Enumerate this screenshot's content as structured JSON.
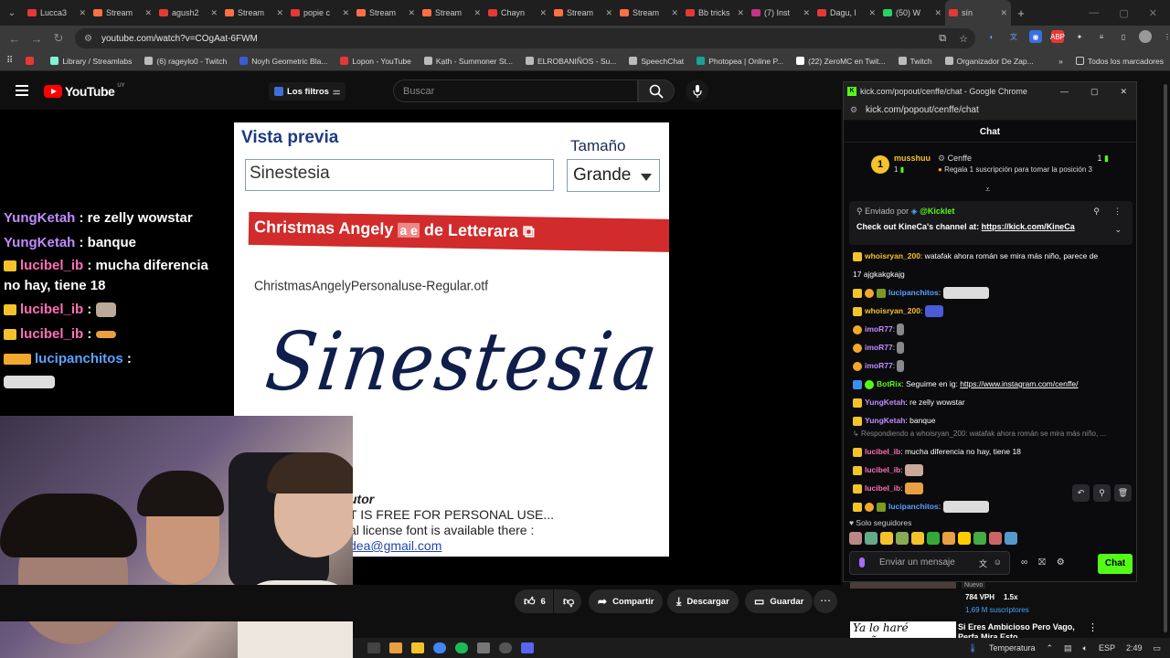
{
  "browser": {
    "tabs": [
      {
        "label": "Lucca3",
        "color": "#e53935"
      },
      {
        "label": "Stream",
        "color": "#ff7043"
      },
      {
        "label": "agush2",
        "color": "#e53935"
      },
      {
        "label": "Stream",
        "color": "#ff7043"
      },
      {
        "label": "popie c",
        "color": "#e53935"
      },
      {
        "label": "Stream",
        "color": "#ff7043"
      },
      {
        "label": "Stream",
        "color": "#ff7043"
      },
      {
        "label": "Chayn",
        "color": "#e53935"
      },
      {
        "label": "Stream",
        "color": "#ff7043"
      },
      {
        "label": "Stream",
        "color": "#ff7043"
      },
      {
        "label": "Bb tricks",
        "color": "#e53935"
      },
      {
        "label": "(7) Inst",
        "color": "#c13584"
      },
      {
        "label": "Dagu, l",
        "color": "#e53935"
      },
      {
        "label": "(50) W",
        "color": "#25d366"
      },
      {
        "label": "sín",
        "color": "#e53935"
      }
    ],
    "url": "youtube.com/watch?v=COgAat-6FWM",
    "bookmarks": [
      {
        "label": "",
        "color": "#e53935"
      },
      {
        "label": "Library / Streamlabs",
        "color": "#80f5d2"
      },
      {
        "label": "(6) rageylo0 - Twitch",
        "color": "#bbbbbb"
      },
      {
        "label": "Noyh Geometric Bla...",
        "color": "#3b5bd6"
      },
      {
        "label": "Lopon - YouTube",
        "color": "#e53935"
      },
      {
        "label": "Kạth - Summoner St...",
        "color": "#bbbbbb"
      },
      {
        "label": "ELROBANIÑOS - Su...",
        "color": "#bbbbbb"
      },
      {
        "label": "SpeechChat",
        "color": "#bbbbbb"
      },
      {
        "label": "Photopea | Online P...",
        "color": "#18a497"
      },
      {
        "label": "(22) ZeroMC en Twit...",
        "color": "#ffffff"
      },
      {
        "label": "Twitch",
        "color": "#bbbbbb"
      },
      {
        "label": "Organizador De Zap...",
        "color": "#bbbbbb"
      }
    ],
    "all_bookmarks": "Todos los marcadores"
  },
  "youtube": {
    "logo": "YouTube",
    "region": "UY",
    "filters": "Los filtros",
    "search_placeholder": "Buscar",
    "likes": "6",
    "share": "Compartir",
    "download": "Descargar",
    "save": "Guardar"
  },
  "preview": {
    "title": "Vista previa",
    "size_label": "Tamaño",
    "input_value": "Sinestesia",
    "select_value": "Grande",
    "red_banner": "Christmas Angely",
    "red_banner_glyphs": "a e",
    "red_banner_author": "de Letterara",
    "filename": "ChristmasAngelyPersonaluse-Regular.otf",
    "script_text": "Sinestesia",
    "foot1": "utor",
    "foot2": "T IS FREE FOR PERSONAL USE...",
    "foot3": "al license font is available there :",
    "foot4": "dea@gmail.com"
  },
  "overlay_chat": [
    {
      "user": "YungKetah",
      "text": " : re zelly wowstar"
    },
    {
      "user": "YungKetah",
      "text": " : banque"
    },
    {
      "user": "lucibel_ib",
      "text": " : mucha diferencia no hay, tiene 18"
    },
    {
      "user": "lucibel_ib",
      "text": " :"
    },
    {
      "user": "lucibel_ib",
      "text": " :"
    },
    {
      "user": "lucipanchitos",
      "text": " :"
    }
  ],
  "popout": {
    "window_title": "kick.com/popout/cenffe/chat - Google Chrome",
    "url": "kick.com/popout/cenffe/chat",
    "header": "Chat",
    "leader_rank": "1",
    "leader_name": "musshuu",
    "leader_count": "1",
    "channel": "Cenffe",
    "sub_text": "Regala 1 suscripción para tomar la posición 3",
    "right_count": "1",
    "pinned_sent_by": "Enviado por",
    "pinned_user": "@Kicklet",
    "pinned_text": "Check out KineCa's channel at: ",
    "pinned_link": "https://kick.com/KineCa",
    "messages": [
      {
        "user": "whoisryan_200",
        "text": ": watafak ahora román se mira más niño, parece de",
        "color": "#f4c32b"
      },
      {
        "user": "",
        "text": "17 ajgkakgkajg",
        "color": "#ffffff"
      },
      {
        "user": "lucipanchitos",
        "text": ":",
        "color": "#5aa2ff"
      },
      {
        "user": "whoisryan_200",
        "text": ":",
        "color": "#f4c32b"
      },
      {
        "user": "imoR77",
        "text": ":",
        "color": "#c08cff"
      },
      {
        "user": "imoR77",
        "text": ":",
        "color": "#c08cff"
      },
      {
        "user": "imoR77",
        "text": ":",
        "color": "#c08cff"
      },
      {
        "user": "BotRix",
        "text": ": Seguime en ig: ",
        "link": "https://www.instagram.com/cenffe/",
        "color": "#53fc18"
      },
      {
        "user": "YungKetah",
        "text": ": re zelly wowstar",
        "color": "#c08cff"
      },
      {
        "user": "YungKetah",
        "text": ": banque",
        "color": "#c08cff"
      },
      {
        "reply": "Respondiendo a whoisryan_200: watafak ahora román se mira más niño, ..."
      },
      {
        "user": "lucibel_ib",
        "text": ": mucha diferencia no hay, tiene 18",
        "color": "#ff6fb7"
      },
      {
        "user": "lucibel_ib",
        "text": ":",
        "color": "#ff6fb7"
      },
      {
        "user": "lucibel_ib",
        "text": ":",
        "color": "#ff6fb7"
      },
      {
        "user": "lucipanchitos",
        "text": ":",
        "color": "#5aa2ff"
      }
    ],
    "followers_only": "Solo seguidores",
    "input_placeholder": "Enviar un mensaje",
    "chat_button": "Chat",
    "accent": "#53fc18"
  },
  "recommended": {
    "badge": "Nuevo",
    "vph": "784 VPH",
    "ratio": "1.5x",
    "subs": "1,69 M suscriptores",
    "thumb_text": "Ya lo haré mañana.",
    "title_line1": "Si Eres Ambicioso Pero Vago,",
    "title_line2": "Perfa Mira Esto"
  },
  "taskbar": {
    "weather": "Temperatura",
    "lang": "ESP",
    "time": "2:49"
  }
}
